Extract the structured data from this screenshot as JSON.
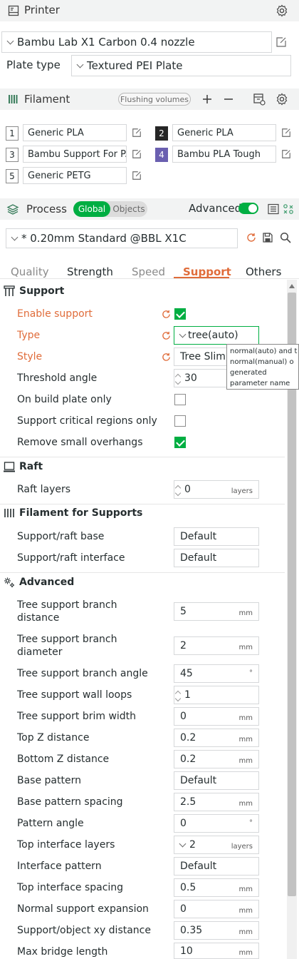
{
  "printer": {
    "title": "Printer",
    "model": "Bambu Lab X1 Carbon 0.4 nozzle",
    "plate_type_label": "Plate type",
    "plate_type_value": "Textured PEI Plate"
  },
  "filament": {
    "title": "Filament",
    "flushing_button": "Flushing volumes",
    "items": [
      {
        "num": "1",
        "name": "Generic PLA"
      },
      {
        "num": "2",
        "name": "Generic PLA"
      },
      {
        "num": "3",
        "name": "Bambu Support For P..."
      },
      {
        "num": "4",
        "name": "Bambu PLA Tough"
      },
      {
        "num": "5",
        "name": "Generic PETG"
      }
    ]
  },
  "process": {
    "title": "Process",
    "toggle_global": "Global",
    "toggle_objects": "Objects",
    "advanced_label": "Advanced",
    "preset": "* 0.20mm Standard @BBL X1C"
  },
  "tabs": [
    "Quality",
    "Strength",
    "Speed",
    "Support",
    "Others"
  ],
  "sections": {
    "support": "Support",
    "raft": "Raft",
    "filament_for_supports": "Filament for Supports",
    "advanced": "Advanced"
  },
  "support": {
    "enable_support": "Enable support",
    "type_label": "Type",
    "type_value": "tree(auto)",
    "style_label": "Style",
    "style_value": "Tree Slim",
    "threshold_label": "Threshold angle",
    "threshold_value": "30",
    "on_build_plate": "On build plate only",
    "critical_regions": "Support critical regions only",
    "remove_small": "Remove small overhangs"
  },
  "tooltip": {
    "line1": "normal(auto) and t",
    "line2": "normal(manual) o",
    "line3": "generated",
    "line4": "parameter name"
  },
  "raft": {
    "raft_layers_label": "Raft layers",
    "raft_layers_value": "0",
    "raft_layers_unit": "layers"
  },
  "fil_support": {
    "base_label": "Support/raft base",
    "base_value": "Default",
    "interface_label": "Support/raft interface",
    "interface_value": "Default"
  },
  "advanced": {
    "branch_distance_l1": "Tree support branch",
    "branch_distance_l2": "distance",
    "branch_distance_value": "5",
    "branch_diameter_l1": "Tree support branch",
    "branch_diameter_l2": "diameter",
    "branch_diameter_value": "2",
    "branch_angle_label": "Tree support branch angle",
    "branch_angle_value": "45",
    "wall_loops_label": "Tree support wall loops",
    "wall_loops_value": "1",
    "brim_width_label": "Tree support brim width",
    "brim_width_value": "0",
    "top_z_label": "Top Z distance",
    "top_z_value": "0.2",
    "bottom_z_label": "Bottom Z distance",
    "bottom_z_value": "0.2",
    "base_pattern_label": "Base pattern",
    "base_pattern_value": "Default",
    "base_spacing_label": "Base pattern spacing",
    "base_spacing_value": "2.5",
    "pattern_angle_label": "Pattern angle",
    "pattern_angle_value": "0",
    "top_interface_layers_label": "Top interface layers",
    "top_interface_layers_value": "2",
    "interface_pattern_label": "Interface pattern",
    "interface_pattern_value": "Default",
    "top_interface_spacing_label": "Top interface spacing",
    "top_interface_spacing_value": "0.5",
    "normal_expansion_label": "Normal support expansion",
    "normal_expansion_value": "0",
    "xy_distance_label": "Support/object xy distance",
    "xy_distance_value": "0.35",
    "max_bridge_label": "Max bridge length",
    "max_bridge_value": "10"
  },
  "units": {
    "mm": "mm",
    "deg": "°",
    "layers": "layers"
  },
  "colors": {
    "accent": "#00ae42",
    "modified": "#e06c3a",
    "header_bg": "#f2f3f3",
    "filament_2": "#262626",
    "filament_4": "#6a5fb0"
  }
}
